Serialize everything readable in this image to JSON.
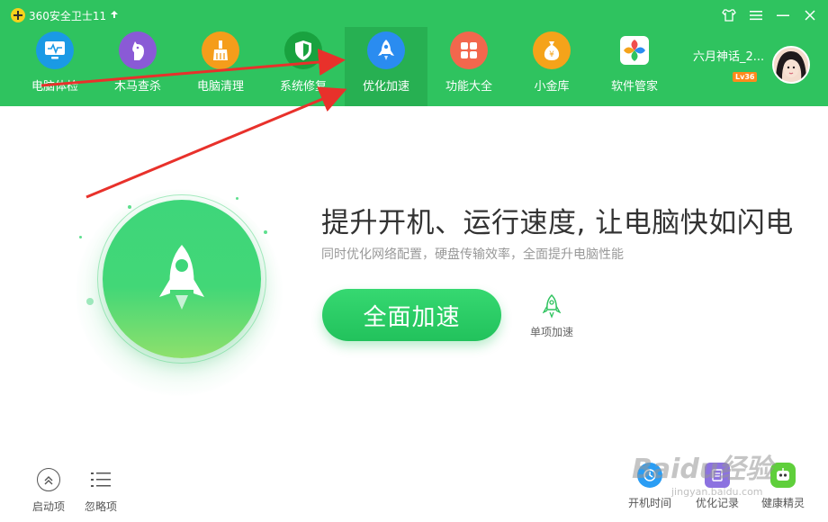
{
  "app": {
    "title": "360安全卫士11",
    "update_icon": "up-arrow-icon"
  },
  "window_controls": [
    {
      "name": "skin-icon"
    },
    {
      "name": "menu-icon"
    },
    {
      "name": "minimize-icon"
    },
    {
      "name": "close-icon"
    }
  ],
  "nav": {
    "items": [
      {
        "label": "电脑体检",
        "icon": "monitor-check-icon",
        "color": "#1a9ae5",
        "active": false
      },
      {
        "label": "木马查杀",
        "icon": "horse-icon",
        "color": "#8a5ad6",
        "active": false
      },
      {
        "label": "电脑清理",
        "icon": "broom-icon",
        "color": "#f59d1b",
        "active": false
      },
      {
        "label": "系统修复",
        "icon": "shield-icon",
        "color": "#19a23f",
        "active": false
      },
      {
        "label": "优化加速",
        "icon": "rocket-icon",
        "color": "#2a8cf0",
        "active": true
      },
      {
        "label": "功能大全",
        "icon": "grid-icon",
        "color": "#f2674d",
        "active": false
      },
      {
        "label": "小金库",
        "icon": "money-bag-icon",
        "color": "#f5a31a",
        "active": false
      },
      {
        "label": "软件管家",
        "icon": "flower-icon",
        "color": "#ffffff",
        "active": false
      }
    ]
  },
  "user": {
    "name": "六月神话_2...",
    "level": "Lv36"
  },
  "main": {
    "headline": "提升开机、运行速度, 让电脑快如闪电",
    "subline": "同时优化网络配置，硬盘传输效率，全面提升电脑性能",
    "primary_button": "全面加速",
    "single_button": "单项加速"
  },
  "bottom": {
    "left": [
      {
        "label": "启动项",
        "icon": "chevron-up-icon"
      },
      {
        "label": "忽略项",
        "icon": "list-icon"
      }
    ],
    "right": [
      {
        "label": "开机时间",
        "icon": "clock-icon"
      },
      {
        "label": "优化记录",
        "icon": "record-icon"
      },
      {
        "label": "健康精灵",
        "icon": "robot-icon"
      }
    ]
  },
  "watermark": {
    "text": "Baidu经验",
    "sub": "jingyan.baidu.com"
  },
  "colors": {
    "header": "#2fc35f",
    "accent": "#22c25c",
    "annotation": "#e8312b"
  }
}
